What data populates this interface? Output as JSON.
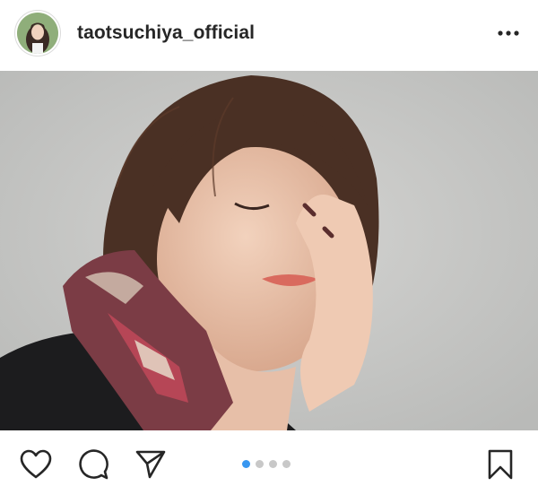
{
  "post": {
    "username": "taotsuchiya_official",
    "more_icon": "more-horizontal-icon"
  },
  "carousel": {
    "current_index": 1,
    "total": 4
  },
  "actions": {
    "like_icon": "heart-icon",
    "comment_icon": "comment-bubble-icon",
    "share_icon": "paper-plane-icon",
    "save_icon": "bookmark-icon"
  },
  "colors": {
    "accent": "#3897f0",
    "text": "#262626",
    "inactive_dot": "#c8c8c8"
  }
}
